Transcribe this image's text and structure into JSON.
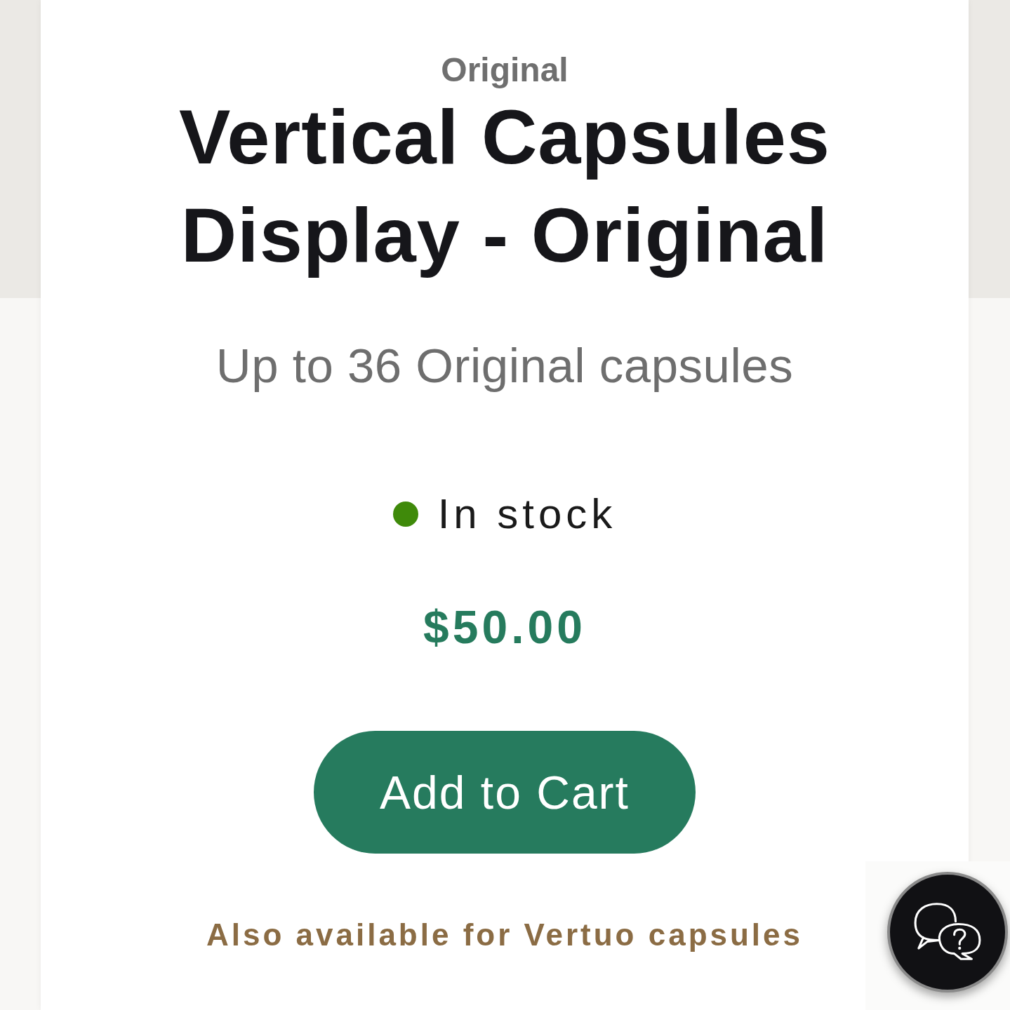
{
  "product": {
    "category": "Original",
    "title": "Vertical Capsules Display - Original",
    "subtitle": "Up to 36 Original capsules",
    "availability": {
      "label": "In stock",
      "in_stock": true
    },
    "price": "$50.00",
    "add_to_cart_button": "Add to Cart",
    "alternate_link": "Also available for Vertuo capsules"
  }
}
